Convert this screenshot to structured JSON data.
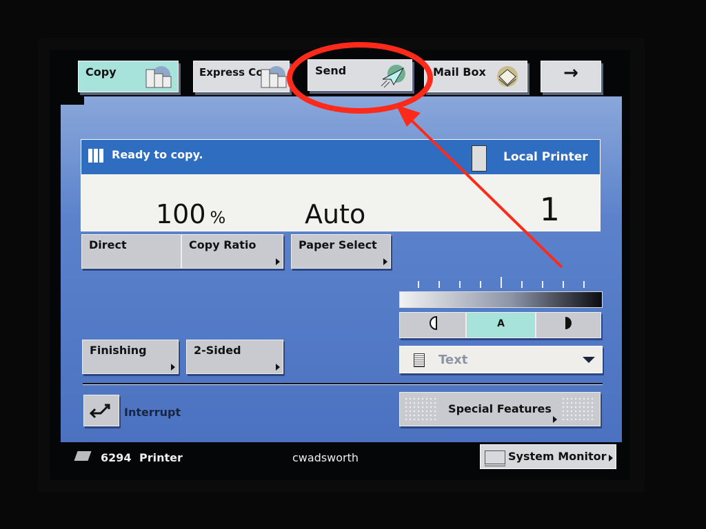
{
  "tabs": [
    {
      "label": "Copy",
      "icon": "copy-pages-icon",
      "active": true
    },
    {
      "label": "Express Copy",
      "icon": "copy-pages-icon",
      "active": false
    },
    {
      "label": "Send",
      "icon": "paper-plane-icon",
      "active": false
    },
    {
      "label": "Mail Box",
      "icon": "mailbox-tray-icon",
      "active": false
    },
    {
      "label": "→",
      "icon": "arrow-right-icon",
      "active": false
    }
  ],
  "status": {
    "message": "Ready to copy.",
    "printer": "Local Printer",
    "ratio": "100",
    "ratio_unit": "%",
    "paper": "Auto",
    "copies": "1"
  },
  "buttons": {
    "direct": "Direct",
    "copy_ratio": "Copy Ratio",
    "paper_select": "Paper Select",
    "finishing": "Finishing",
    "two_sided": "2-Sided",
    "interrupt": "Interrupt",
    "special_features": "Special Features"
  },
  "density": {
    "auto_label": "A",
    "auto_selected": true,
    "level": 5,
    "levels": 9
  },
  "image_type": {
    "selected": "Text"
  },
  "footer": {
    "job_id": "6294",
    "job_type": "Printer",
    "user": "cwadsworth",
    "system_monitor": "System Monitor"
  },
  "colors": {
    "active_tab": "#a7e3da",
    "panel": "#4b72c0",
    "status_header": "#2f6dc0",
    "annotation": "#ff2a1a"
  }
}
